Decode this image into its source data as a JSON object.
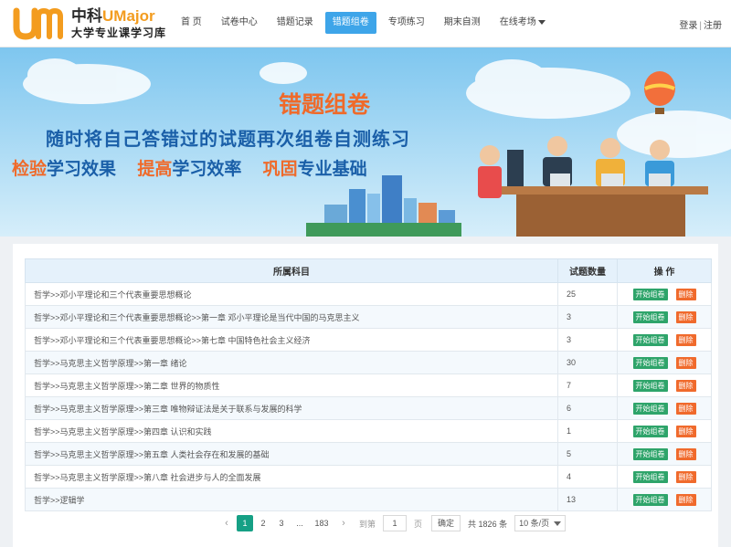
{
  "logo": {
    "brand_cn": "中科",
    "brand_en": "UMajor",
    "tagline": "大学专业课学习库"
  },
  "nav": [
    {
      "label": "首 页"
    },
    {
      "label": "试卷中心"
    },
    {
      "label": "错题记录"
    },
    {
      "label": "错题组卷",
      "active": true
    },
    {
      "label": "专项练习"
    },
    {
      "label": "期末自测"
    },
    {
      "label": "在线考场",
      "dropdown": true
    }
  ],
  "auth": {
    "login": "登录",
    "separator": "|",
    "register": "注册"
  },
  "banner": {
    "title": "错题组卷",
    "subtitle": "随时将自己答错过的试题再次组卷自测练习",
    "slogans": [
      {
        "accent": "检验",
        "rest": "学习效果"
      },
      {
        "accent": "提高",
        "rest": "学习效率"
      },
      {
        "accent": "巩固",
        "rest": "专业基础"
      }
    ]
  },
  "table": {
    "headers": {
      "subject": "所属科目",
      "count": "试题数量",
      "ops": "操 作"
    },
    "start_label": "开始组卷",
    "delete_label": "删除",
    "rows": [
      {
        "subject": "哲学>>邓小平理论和三个代表重要思想概论",
        "count": "25"
      },
      {
        "subject": "哲学>>邓小平理论和三个代表重要思想概论>>第一章 邓小平理论是当代中国的马克思主义",
        "count": "3"
      },
      {
        "subject": "哲学>>邓小平理论和三个代表重要思想概论>>第七章 中国特色社会主义经济",
        "count": "3"
      },
      {
        "subject": "哲学>>马克思主义哲学原理>>第一章 绪论",
        "count": "30"
      },
      {
        "subject": "哲学>>马克思主义哲学原理>>第二章 世界的物质性",
        "count": "7"
      },
      {
        "subject": "哲学>>马克思主义哲学原理>>第三章 唯物辩证法是关于联系与发展的科学",
        "count": "6"
      },
      {
        "subject": "哲学>>马克思主义哲学原理>>第四章 认识和实践",
        "count": "1"
      },
      {
        "subject": "哲学>>马克思主义哲学原理>>第五章 人类社会存在和发展的基础",
        "count": "5"
      },
      {
        "subject": "哲学>>马克思主义哲学原理>>第八章 社会进步与人的全面发展",
        "count": "4"
      },
      {
        "subject": "哲学>>逻辑学",
        "count": "13"
      }
    ]
  },
  "pagination": {
    "prev": "‹",
    "pages": [
      "1",
      "2",
      "3"
    ],
    "ellipsis": "...",
    "last": "183",
    "next": "›",
    "goto_label": "到第",
    "goto_value": "1",
    "page_unit": "页",
    "confirm": "确定",
    "total": "共 1826 条",
    "page_size": "10 条/页"
  },
  "colors": {
    "accent": "#3ea5e9",
    "start_btn": "#2ea46a",
    "delete_btn": "#f06a2c",
    "active_page": "#16a085",
    "brand_orange": "#f39c1f"
  }
}
